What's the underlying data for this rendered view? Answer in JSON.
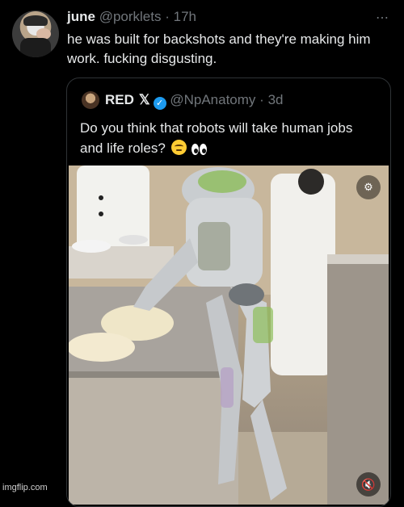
{
  "tweet": {
    "display_name": "june",
    "handle": "@porklets",
    "separator": "·",
    "time": "17h",
    "more_icon": "⋯",
    "text": "he was built for backshots and they're making him work. fucking disgusting."
  },
  "quoted_tweet": {
    "display_name": "RED",
    "x_badge": "𝕏",
    "verified_icon": "✓",
    "handle": "@NpAnatomy",
    "separator": "·",
    "time": "3d",
    "text": "Do you think that robots will take human jobs and life roles?",
    "emojis": [
      "face-with-rolling-eyes",
      "eyes"
    ],
    "video": {
      "top_icon": "gif-settings-icon",
      "top_icon_glyph": "⚙",
      "sound_icon": "speaker-muted-icon",
      "sound_icon_glyph": "🔇"
    }
  },
  "watermark": "imgflip.com",
  "colors": {
    "background": "#000000",
    "text": "#e7e9ea",
    "muted": "#71767b",
    "verified": "#1d9bf0",
    "border": "#2f3336"
  }
}
